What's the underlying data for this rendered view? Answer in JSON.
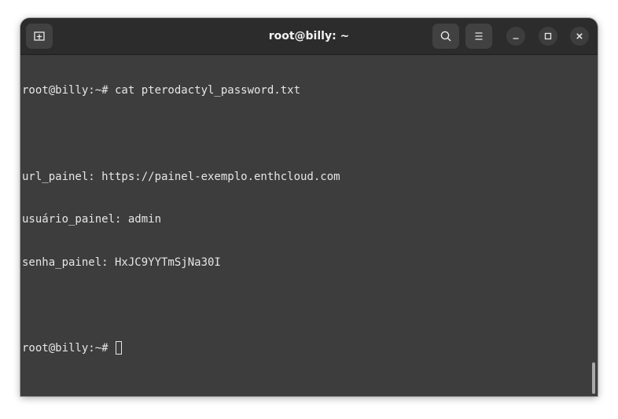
{
  "window": {
    "title": "root@billy: ~"
  },
  "terminal": {
    "lines": [
      "root@billy:~# cat pterodactyl_password.txt",
      "",
      "url_painel: https://painel-exemplo.enthcloud.com",
      "usuário_painel: admin",
      "senha_painel: HxJC9YYTmSjNa30I",
      "",
      "root@billy:~# "
    ]
  },
  "icons": {
    "new_tab": "new-tab-icon",
    "search": "search-icon",
    "menu": "hamburger-menu-icon",
    "minimize": "minimize-icon",
    "maximize": "maximize-icon",
    "close": "close-icon"
  },
  "colors": {
    "terminal_bg": "#3d3d3d",
    "titlebar_bg": "#2c2c2c",
    "text": "#e6e6e6"
  }
}
